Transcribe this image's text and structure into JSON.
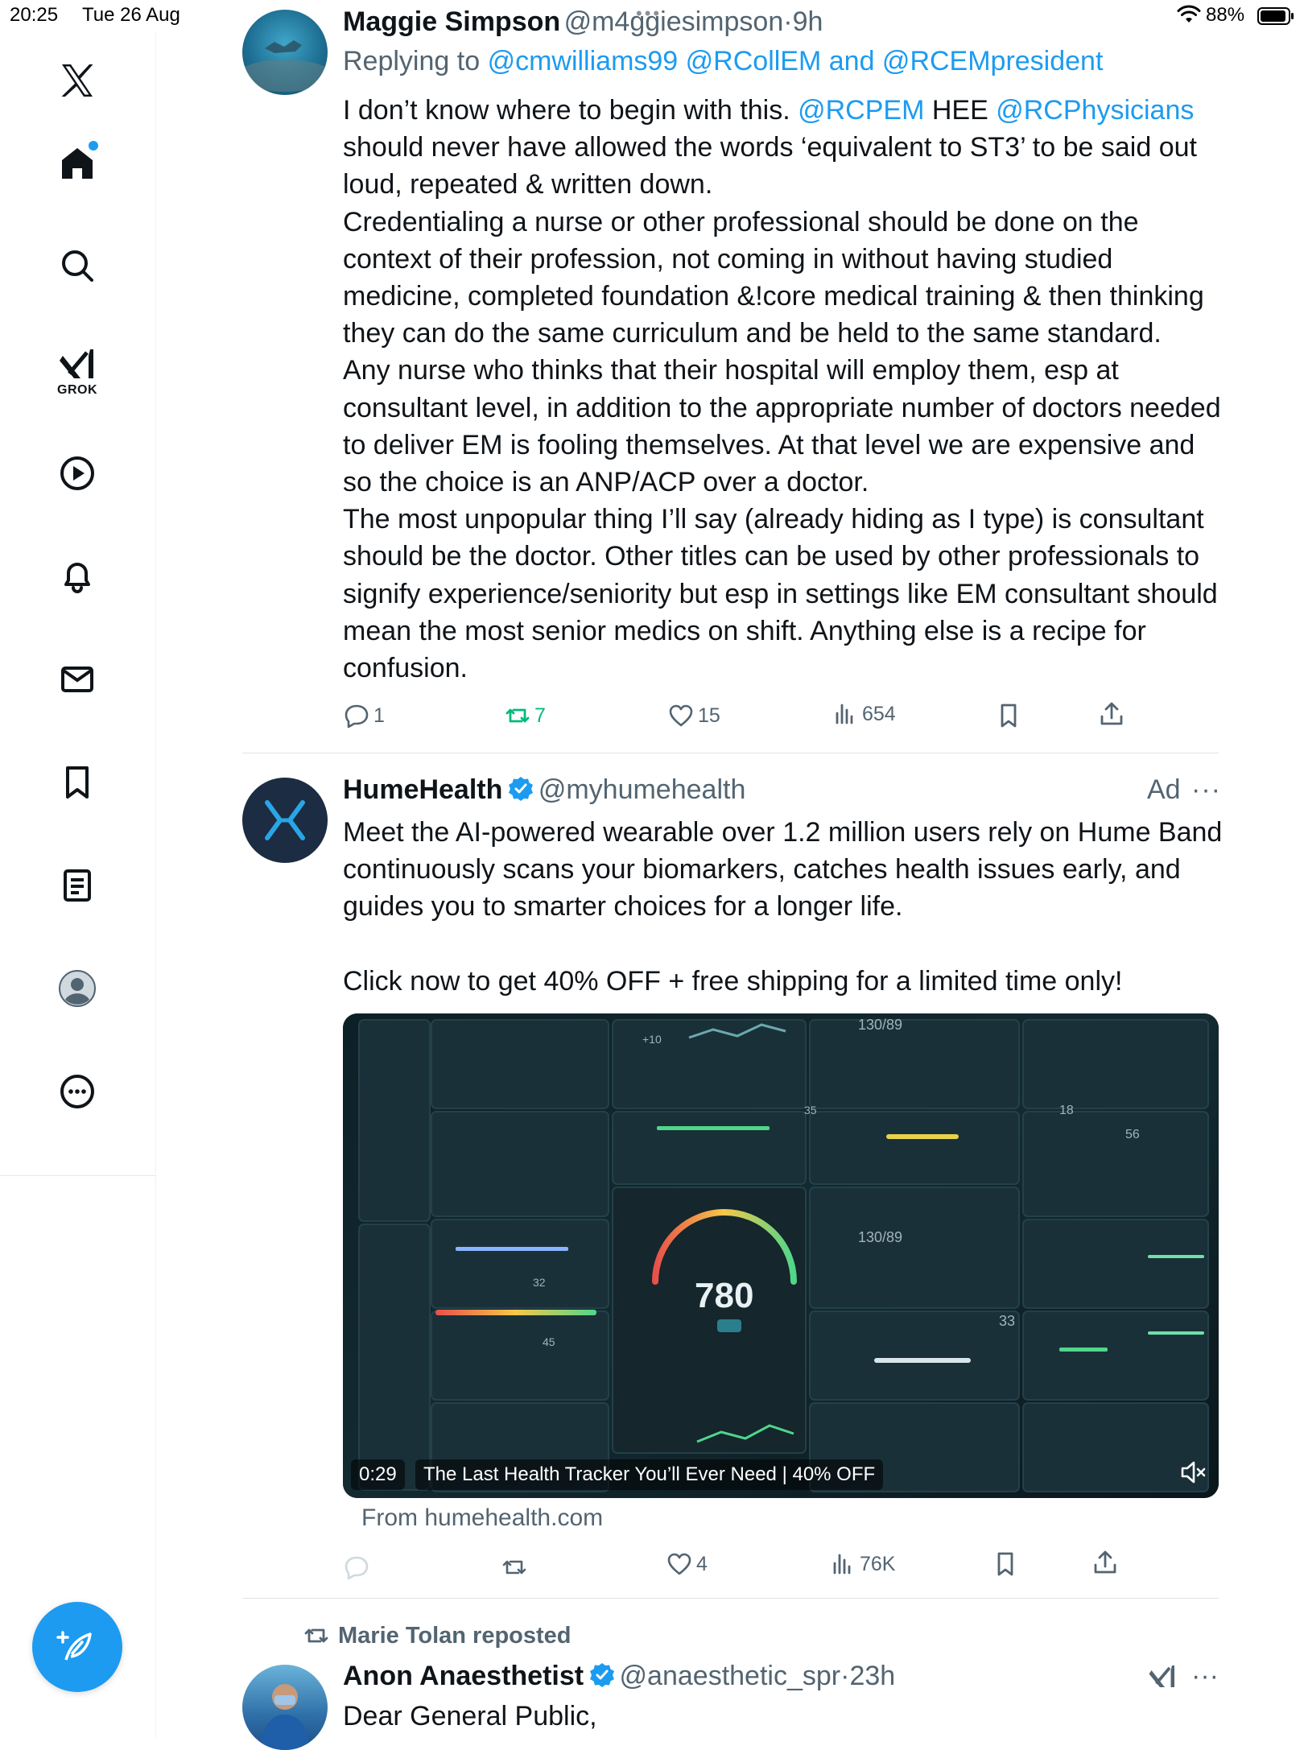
{
  "status_bar": {
    "time": "20:25",
    "date": "Tue 26 Aug",
    "battery_percent": "88%"
  },
  "sidebar": {
    "items": [
      {
        "name": "x-logo",
        "icon": "x-logo"
      },
      {
        "name": "home",
        "icon": "home-icon",
        "notification_dot": true
      },
      {
        "name": "search",
        "icon": "search-icon"
      },
      {
        "name": "grok",
        "icon": "grok-icon",
        "label": "GROK"
      },
      {
        "name": "videos",
        "icon": "play-icon"
      },
      {
        "name": "notifications",
        "icon": "bell-icon"
      },
      {
        "name": "messages",
        "icon": "envelope-icon"
      },
      {
        "name": "bookmarks",
        "icon": "bookmark-icon"
      },
      {
        "name": "lists",
        "icon": "list-icon"
      },
      {
        "name": "profile",
        "icon": "avatar-icon"
      },
      {
        "name": "more",
        "icon": "more-circle-icon"
      }
    ],
    "compose_icon": "compose-icon"
  },
  "colors": {
    "accent": "#1d9bf0",
    "text": "#0f1419",
    "secondary": "#536471",
    "retweet_active": "#00ba7c"
  },
  "tweet1": {
    "name": "Maggie Simpson",
    "handle": "@m4ggiesimpson",
    "time": "9h",
    "replying_label": "Replying to",
    "replying_to": "@cmwilliams99 @RCollEM and @RCEMpresident",
    "text_intro": "I don’t know where to begin with this.",
    "mention1": "@RCPEM",
    "mid": "HEE",
    "mention2": "@RCPhysicians",
    "text_body": "should never have allowed the words ‘equivalent to ST3’ to be said out loud, repeated & written down.\nCredentialing a nurse or other professional should be done on the context of their profession, not coming in without having studied medicine, completed foundation &!core medical training & then thinking they can do the same curriculum and be held to the same standard.\nAny nurse who thinks that their hospital will employ them, esp at consultant level, in addition to the appropriate number of doctors needed to deliver EM is fooling themselves. At that level we are expensive and so the choice is an ANP/ACP over a doctor.\nThe most unpopular thing I’ll say (already hiding as I type) is consultant should be the doctor. Other titles can be used by other professionals to signify experience/seniority but esp in settings like EM consultant should mean the most senior medics on shift. Anything else is a recipe for confusion.",
    "replies": "1",
    "retweets": "7",
    "likes": "15",
    "views": "654"
  },
  "ad": {
    "name": "HumeHealth",
    "handle": "@myhumehealth",
    "ad_label": "Ad",
    "text": "Meet the AI-powered wearable over 1.2 million users rely on Hume Band continuously scans your biomarkers, catches health issues early, and guides you to smarter choices for a longer life.\n\nClick now to get 40% OFF + free shipping for a limited time only!",
    "video_duration": "0:29",
    "video_title": "The Last Health Tracker You’ll Ever Need | 40% OFF",
    "gauge_value": "780",
    "from_site": "From humehealth.com",
    "likes": "4",
    "views": "76K",
    "media_labels": {
      "bp1": "130/89",
      "bp2": "130/89",
      "n18": "18",
      "n56": "56",
      "n32": "32",
      "n45": "45",
      "n33": "33",
      "n35": "35",
      "p10": "+10"
    }
  },
  "tweet3": {
    "reposted_by": "Marie Tolan reposted",
    "name": "Anon Anaesthetist",
    "handle": "@anaesthetic_spr",
    "time": "23h",
    "text": "Dear General Public,"
  }
}
